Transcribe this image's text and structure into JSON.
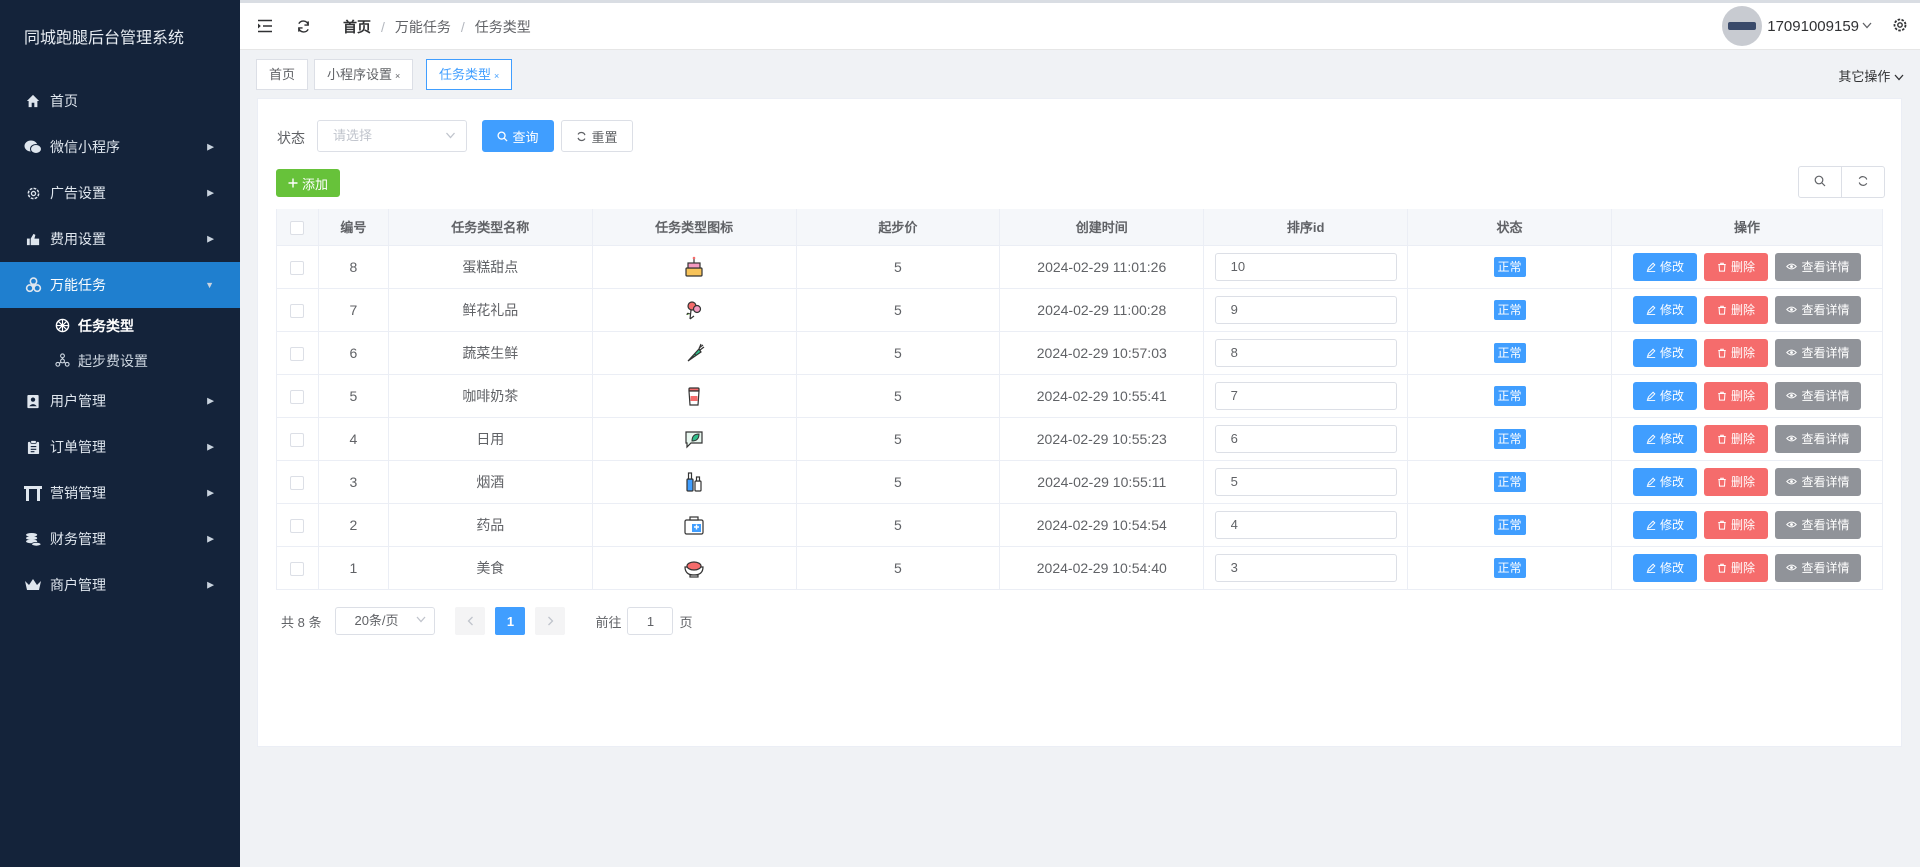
{
  "app": {
    "title": "同城跑腿后台管理系统"
  },
  "sidebar": {
    "items": [
      {
        "label": "首页",
        "icon": "home-icon",
        "has_arrow": false
      },
      {
        "label": "微信小程序",
        "icon": "wechat-icon",
        "has_arrow": true
      },
      {
        "label": "广告设置",
        "icon": "gear-icon",
        "has_arrow": true
      },
      {
        "label": "费用设置",
        "icon": "thumb-icon",
        "has_arrow": true
      },
      {
        "label": "万能任务",
        "icon": "biohazard-icon",
        "has_arrow": true,
        "active": true
      },
      {
        "label": "用户管理",
        "icon": "user-icon",
        "has_arrow": true
      },
      {
        "label": "订单管理",
        "icon": "clipboard-icon",
        "has_arrow": true
      },
      {
        "label": "营销管理",
        "icon": "gate-icon",
        "has_arrow": true
      },
      {
        "label": "财务管理",
        "icon": "coins-icon",
        "has_arrow": true
      },
      {
        "label": "商户管理",
        "icon": "crown-icon",
        "has_arrow": true
      }
    ],
    "subitems": [
      {
        "label": "任务类型",
        "icon": "wheel-icon",
        "active": true
      },
      {
        "label": "起步费设置",
        "icon": "molecule-icon",
        "active": false
      }
    ]
  },
  "header": {
    "breadcrumb": [
      "首页",
      "万能任务",
      "任务类型"
    ],
    "username": "17091009159"
  },
  "tags": {
    "items": [
      {
        "label": "首页",
        "closable": false
      },
      {
        "label": "小程序设置",
        "closable": true
      },
      {
        "label": "任务类型",
        "closable": true,
        "active": true
      }
    ],
    "close_glyph": "×",
    "other_ops": "其它操作"
  },
  "filter": {
    "status_label": "状态",
    "status_placeholder": "请选择",
    "query_label": "查询",
    "reset_label": "重置",
    "add_label": "添加"
  },
  "table": {
    "columns": [
      "编号",
      "任务类型名称",
      "任务类型图标",
      "起步价",
      "创建时间",
      "排序id",
      "状态",
      "操作"
    ],
    "rows": [
      {
        "id": "8",
        "name": "蛋糕甜点",
        "icon": "cake-icon",
        "price": "5",
        "created": "2024-02-29 11:01:26",
        "sort": "10",
        "status": "正常"
      },
      {
        "id": "7",
        "name": "鲜花礼品",
        "icon": "flower-icon",
        "price": "5",
        "created": "2024-02-29 11:00:28",
        "sort": "9",
        "status": "正常"
      },
      {
        "id": "6",
        "name": "蔬菜生鲜",
        "icon": "carrot-icon",
        "price": "5",
        "created": "2024-02-29 10:57:03",
        "sort": "8",
        "status": "正常"
      },
      {
        "id": "5",
        "name": "咖啡奶茶",
        "icon": "coffee-icon",
        "price": "5",
        "created": "2024-02-29 10:55:41",
        "sort": "7",
        "status": "正常"
      },
      {
        "id": "4",
        "name": "日用",
        "icon": "chat-leaf-icon",
        "price": "5",
        "created": "2024-02-29 10:55:23",
        "sort": "6",
        "status": "正常"
      },
      {
        "id": "3",
        "name": "烟酒",
        "icon": "bottles-icon",
        "price": "5",
        "created": "2024-02-29 10:55:11",
        "sort": "5",
        "status": "正常"
      },
      {
        "id": "2",
        "name": "药品",
        "icon": "medicine-icon",
        "price": "5",
        "created": "2024-02-29 10:54:54",
        "sort": "4",
        "status": "正常"
      },
      {
        "id": "1",
        "name": "美食",
        "icon": "hotpot-icon",
        "price": "5",
        "created": "2024-02-29 10:54:40",
        "sort": "3",
        "status": "正常"
      }
    ],
    "op_edit": "修改",
    "op_delete": "删除",
    "op_view": "查看详情"
  },
  "pagination": {
    "total": "共 8 条",
    "page_size": "20条/页",
    "current_page": "1",
    "goto_label": "前往",
    "goto_value": "1",
    "page_unit": "页"
  },
  "colors": {
    "sidebar_bg": "#14233a",
    "active_menu": "#1f7fcf",
    "primary": "#409eff",
    "danger": "#f56c6c",
    "info": "#909399",
    "success": "#67c23a"
  }
}
